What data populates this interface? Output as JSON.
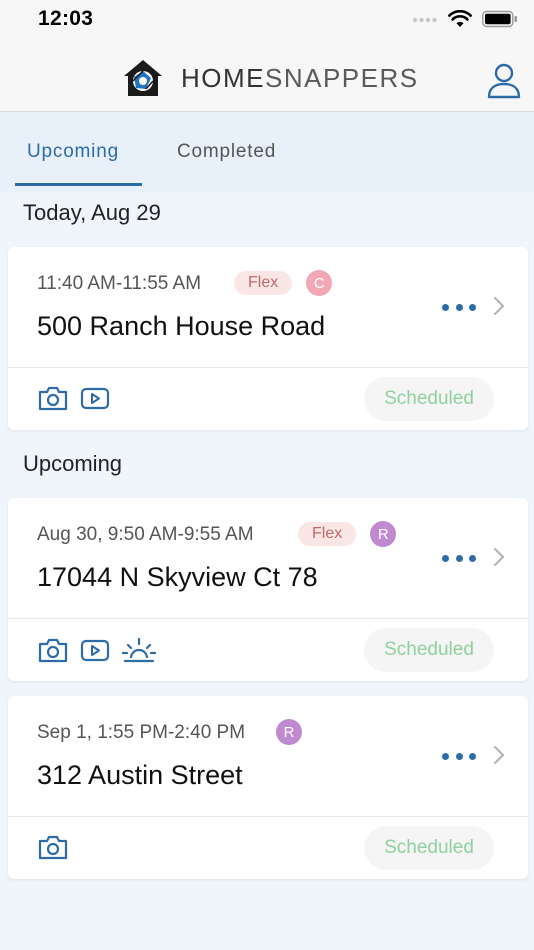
{
  "status_bar": {
    "time": "12:03"
  },
  "header": {
    "logo_home": "HOME",
    "logo_snappers": "SNAPPERS"
  },
  "tabs": [
    {
      "label": "Upcoming",
      "active": true
    },
    {
      "label": "Completed",
      "active": false
    }
  ],
  "sections": [
    {
      "title": "Today, Aug 29"
    },
    {
      "title": "Upcoming"
    }
  ],
  "cards": [
    {
      "time": "11:40 AM-11:55 AM",
      "flex": "Flex",
      "avatar": "C",
      "avatar_color": "#f2a7b4",
      "address": "500 Ranch House Road",
      "icons": [
        "camera-icon",
        "video-icon"
      ],
      "status": "Scheduled"
    },
    {
      "time": "Aug 30, 9:50 AM-9:55 AM",
      "flex": "Flex",
      "avatar": "R",
      "avatar_color": "#c08ad1",
      "address": "17044 N Skyview Ct 78",
      "icons": [
        "camera-icon",
        "video-icon",
        "sunset-icon"
      ],
      "status": "Scheduled"
    },
    {
      "time": "Sep 1, 1:55 PM-2:40 PM",
      "avatar": "R",
      "avatar_color": "#c08ad1",
      "address": "312 Austin Street",
      "icons": [
        "camera-icon"
      ],
      "status": "Scheduled"
    }
  ],
  "colors": {
    "accent": "#2e6ca8",
    "status_green": "#8fd19e",
    "flex_bg": "#fbe6e6",
    "flex_text": "#c26a6a"
  }
}
